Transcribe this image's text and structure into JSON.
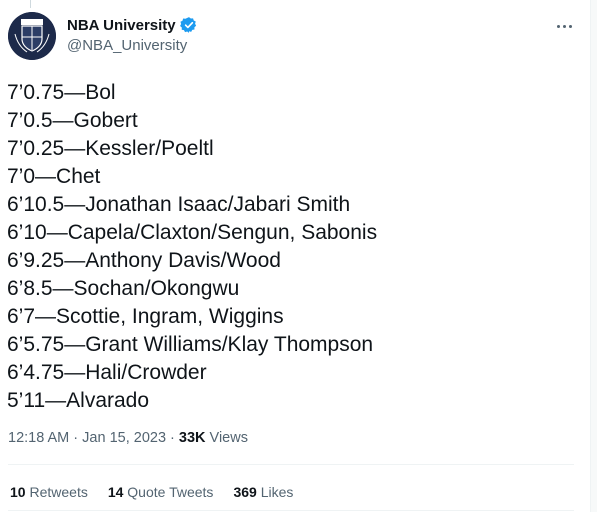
{
  "author": {
    "display_name": "NBA University",
    "handle": "@NBA_University",
    "avatar_icon": "nbau-crest-logo",
    "verified_icon": "verified-badge-icon"
  },
  "tweet_lines": [
    "7’0.75—Bol",
    "7’0.5—Gobert",
    "7’0.25—Kessler/Poeltl",
    "7’0—Chet",
    "6’10.5—Jonathan Isaac/Jabari Smith",
    "6’10—Capela/Claxton/Sengun, Sabonis",
    "6’9.25—Anthony Davis/Wood",
    "6’8.5—Sochan/Okongwu",
    "6’7—Scottie, Ingram, Wiggins",
    "6’5.75—Grant Williams/Klay Thompson",
    "6’4.75—Hali/Crowder",
    "5’11—Alvarado"
  ],
  "meta": {
    "time": "12:18 AM",
    "separator": " · ",
    "date": "Jan 15, 2023",
    "views_count": "33K",
    "views_label": " Views"
  },
  "stats": {
    "retweets_count": "10",
    "retweets_label": "Retweets",
    "quotes_count": "14",
    "quotes_label": "Quote Tweets",
    "likes_count": "369",
    "likes_label": "Likes"
  },
  "colors": {
    "text_primary": "#0f1419",
    "text_secondary": "#536471",
    "verified_blue": "#1d9bf0",
    "divider": "#eff3f4"
  }
}
